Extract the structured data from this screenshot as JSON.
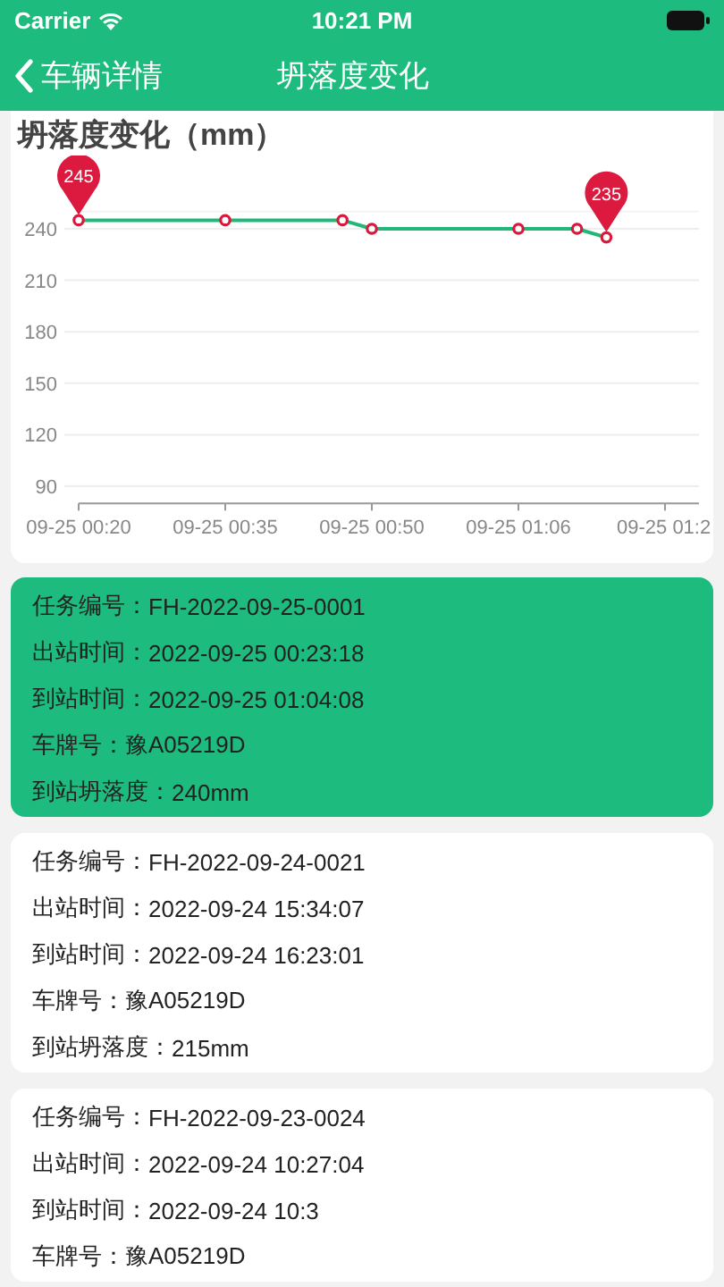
{
  "status_bar": {
    "carrier": "Carrier",
    "time": "10:21 PM"
  },
  "nav_bar": {
    "back_label": "车辆详情",
    "title": "坍落度变化"
  },
  "chart": {
    "title": "坍落度变化（mm）",
    "chart_data": {
      "type": "line",
      "categories": [
        "09-25 00:20",
        null,
        null,
        null,
        null,
        "09-25 00:35",
        null,
        null,
        null,
        null,
        "09-25 00:50",
        null,
        null,
        null,
        null,
        "09-25 01:06",
        null,
        null,
        null,
        null,
        "09-25 01:2"
      ],
      "series": [
        {
          "color": "#20b879",
          "marker": "circle",
          "values": [
            245,
            null,
            null,
            null,
            null,
            245,
            null,
            null,
            null,
            245,
            240,
            null,
            null,
            null,
            null,
            240,
            null,
            240,
            235,
            null,
            null
          ]
        }
      ],
      "ylim": [
        80,
        250
      ],
      "yticks": [
        90,
        120,
        150,
        180,
        210,
        240
      ],
      "grid": true,
      "annotations": [
        {
          "x": "09-25 00:20",
          "y": 245,
          "text": "245"
        },
        {
          "y": 235,
          "text": "235"
        }
      ]
    }
  },
  "records": [
    {
      "selected": true,
      "fields": [
        {
          "label": "任务编号：",
          "value": "FH-2022-09-25-0001"
        },
        {
          "label": "出站时间：",
          "value": "2022-09-25 00:23:18"
        },
        {
          "label": "到站时间：",
          "value": "2022-09-25 01:04:08"
        },
        {
          "label": "车牌号：",
          "value": "豫A05219D"
        },
        {
          "label": "到站坍落度：",
          "value": "240mm"
        }
      ]
    },
    {
      "selected": false,
      "fields": [
        {
          "label": "任务编号：",
          "value": "FH-2022-09-24-0021"
        },
        {
          "label": "出站时间：",
          "value": "2022-09-24 15:34:07"
        },
        {
          "label": "到站时间：",
          "value": "2022-09-24 16:23:01"
        },
        {
          "label": "车牌号：",
          "value": "豫A05219D"
        },
        {
          "label": "到站坍落度：",
          "value": "215mm"
        }
      ]
    },
    {
      "selected": false,
      "fields": [
        {
          "label": "任务编号：",
          "value": "FH-2022-09-23-0024"
        },
        {
          "label": "出站时间：",
          "value": "2022-09-24 10:27:04"
        },
        {
          "label": "到站时间：",
          "value": "2022-09-24 10:3"
        },
        {
          "label": "车牌号：",
          "value": "豫A05219D"
        }
      ]
    }
  ]
}
